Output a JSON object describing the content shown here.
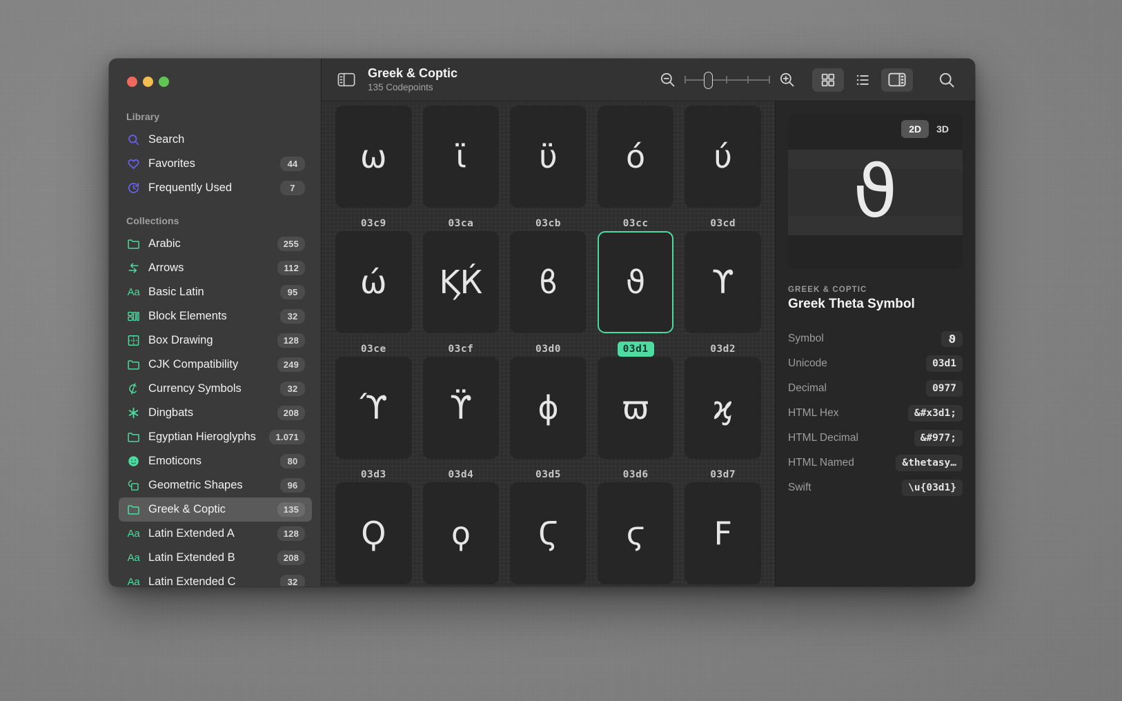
{
  "window": {
    "traffic_lights": [
      "close",
      "minimize",
      "zoom"
    ]
  },
  "sidebar": {
    "library_header": "Library",
    "library_items": [
      {
        "label": "Search",
        "icon": "magnifier-icon",
        "badge": ""
      },
      {
        "label": "Favorites",
        "icon": "heart-icon",
        "badge": "44"
      },
      {
        "label": "Frequently Used",
        "icon": "clock-icon",
        "badge": "7"
      }
    ],
    "collections_header": "Collections",
    "collections": [
      {
        "label": "Arabic",
        "icon": "folder-icon",
        "badge": "255"
      },
      {
        "label": "Arrows",
        "icon": "arrows-icon",
        "badge": "112"
      },
      {
        "label": "Basic Latin",
        "icon": "aa-icon",
        "badge": "95"
      },
      {
        "label": "Block Elements",
        "icon": "blocks-icon",
        "badge": "32"
      },
      {
        "label": "Box Drawing",
        "icon": "box-drawing-icon",
        "badge": "128"
      },
      {
        "label": "CJK Compatibility",
        "icon": "folder-icon",
        "badge": "249"
      },
      {
        "label": "Currency Symbols",
        "icon": "currency-icon",
        "badge": "32"
      },
      {
        "label": "Dingbats",
        "icon": "asterisk-icon",
        "badge": "208"
      },
      {
        "label": "Egyptian Hieroglyphs",
        "icon": "folder-icon",
        "badge": "1.071"
      },
      {
        "label": "Emoticons",
        "icon": "smiley-icon",
        "badge": "80"
      },
      {
        "label": "Geometric Shapes",
        "icon": "shapes-icon",
        "badge": "96"
      },
      {
        "label": "Greek & Coptic",
        "icon": "folder-icon",
        "badge": "135",
        "selected": true
      },
      {
        "label": "Latin Extended A",
        "icon": "aa-icon",
        "badge": "128"
      },
      {
        "label": "Latin Extended B",
        "icon": "aa-icon",
        "badge": "208"
      },
      {
        "label": "Latin Extended C",
        "icon": "aa-icon",
        "badge": "32"
      }
    ]
  },
  "toolbar": {
    "sidebar_toggle_icon": "sidebar-left-icon",
    "title": "Greek & Coptic",
    "subtitle": "135 Codepoints",
    "zoom_out_icon": "zoom-out-icon",
    "zoom_in_icon": "zoom-in-icon",
    "slider_value": 25,
    "grid_view_icon": "grid-view-icon",
    "list_view_icon": "list-view-icon",
    "inspector_toggle_icon": "sidebar-right-icon",
    "search_icon": "search-icon",
    "grid_view_active": true,
    "inspector_active": true
  },
  "grid": {
    "cells": [
      {
        "glyph": "ω",
        "code": "03c9"
      },
      {
        "glyph": "ϊ",
        "code": "03ca"
      },
      {
        "glyph": "ϋ",
        "code": "03cb"
      },
      {
        "glyph": "ό",
        "code": "03cc"
      },
      {
        "glyph": "ύ",
        "code": "03cd"
      },
      {
        "glyph": "ώ",
        "code": "03ce"
      },
      {
        "glyph": "ϏЌ",
        "code": "03cf"
      },
      {
        "glyph": "ϐ",
        "code": "03d0"
      },
      {
        "glyph": "ϑ",
        "code": "03d1",
        "selected": true
      },
      {
        "glyph": "ϒ",
        "code": "03d2"
      },
      {
        "glyph": "ϓ",
        "code": "03d3"
      },
      {
        "glyph": "ϔ",
        "code": "03d4"
      },
      {
        "glyph": "ϕ",
        "code": "03d5"
      },
      {
        "glyph": "ϖ",
        "code": "03d6"
      },
      {
        "glyph": "ϗ",
        "code": "03d7"
      },
      {
        "glyph": "Ϙ",
        "code": ""
      },
      {
        "glyph": "ϙ",
        "code": ""
      },
      {
        "glyph": "Ϛ",
        "code": ""
      },
      {
        "glyph": "ϛ",
        "code": ""
      },
      {
        "glyph": "Ϝ",
        "code": ""
      }
    ]
  },
  "detail": {
    "dimension_2d": "2D",
    "dimension_3d": "3D",
    "dimension_active": "2D",
    "preview_glyph": "ϑ",
    "kicker": "GREEK & COPTIC",
    "name": "Greek Theta Symbol",
    "properties": [
      {
        "label": "Symbol",
        "value": "ϑ",
        "mono": false
      },
      {
        "label": "Unicode",
        "value": "03d1",
        "mono": true
      },
      {
        "label": "Decimal",
        "value": "0977",
        "mono": true
      },
      {
        "label": "HTML Hex",
        "value": "&#x3d1;",
        "mono": true
      },
      {
        "label": "HTML Decimal",
        "value": "&#977;",
        "mono": true
      },
      {
        "label": "HTML Named",
        "value": "&thetasy…",
        "mono": true
      },
      {
        "label": "Swift",
        "value": "\\u{03d1}",
        "mono": true
      }
    ]
  },
  "colors": {
    "accent_green": "#4ddba2",
    "accent_blue": "#6a63f5",
    "window_bg": "#2b2b2b",
    "sidebar_bg": "#3a3a3a"
  }
}
